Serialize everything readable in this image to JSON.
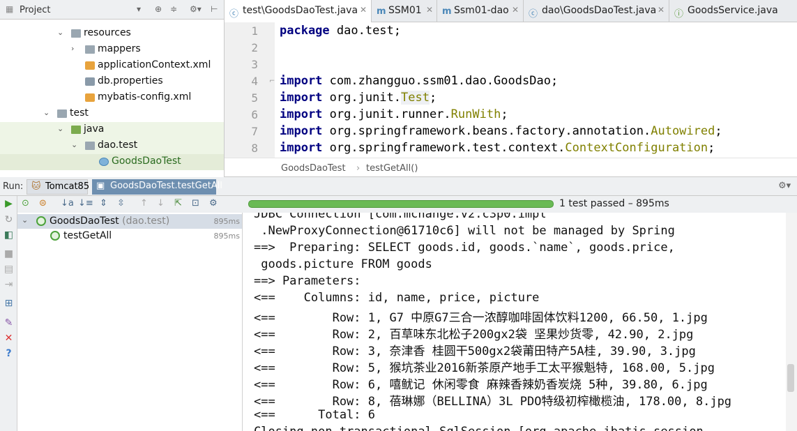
{
  "project_panel": {
    "title": "Project",
    "tree": [
      {
        "label": "resources",
        "kind": "folder",
        "expanded": true
      },
      {
        "label": "mappers",
        "kind": "folder",
        "expanded": false
      },
      {
        "label": "applicationContext.xml",
        "kind": "xml"
      },
      {
        "label": "db.properties",
        "kind": "properties"
      },
      {
        "label": "mybatis-config.xml",
        "kind": "xml"
      },
      {
        "label": "test",
        "kind": "folder",
        "expanded": true
      },
      {
        "label": "java",
        "kind": "folder-green",
        "expanded": true
      },
      {
        "label": "dao.test",
        "kind": "package",
        "expanded": true
      },
      {
        "label": "GoodsDaoTest",
        "kind": "class",
        "selected": true
      }
    ]
  },
  "editor": {
    "tabs": [
      {
        "label": "test\\GoodsDaoTest.java",
        "icon": "class-icon",
        "active": true
      },
      {
        "label": "SSM01",
        "icon": "module-icon"
      },
      {
        "label": "Ssm01-dao",
        "icon": "module-icon"
      },
      {
        "label": "dao\\GoodsDaoTest.java",
        "icon": "class-icon"
      },
      {
        "label": "GoodsService.java",
        "icon": "interface-icon"
      }
    ],
    "line_numbers": [
      "1",
      "2",
      "3",
      "4",
      "5",
      "6",
      "7",
      "8"
    ],
    "code": [
      {
        "kw": "package",
        "rest": " dao.test;",
        "ann": "",
        "tail": ""
      },
      {
        "kw": "",
        "rest": "",
        "ann": "",
        "tail": ""
      },
      {
        "kw": "",
        "rest": "",
        "ann": "",
        "tail": ""
      },
      {
        "kw": "import",
        "rest": " com.zhangguo.ssm01.dao.GoodsDao;",
        "ann": "",
        "tail": ""
      },
      {
        "kw": "import",
        "rest": " org.junit.",
        "ann": "Test",
        "tail": ";"
      },
      {
        "kw": "import",
        "rest": " org.junit.runner.",
        "ann": "RunWith",
        "tail": ";"
      },
      {
        "kw": "import",
        "rest": " org.springframework.beans.factory.annotation.",
        "ann": "Autowired",
        "tail": ";"
      },
      {
        "kw": "import",
        "rest": " org.springframework.test.context.",
        "ann": "ContextConfiguration",
        "tail": ";"
      }
    ],
    "breadcrumb": [
      "GoodsDaoTest",
      "testGetAll()"
    ]
  },
  "run": {
    "label": "Run:",
    "tabs": [
      "Tomcat85",
      "GoodsDaoTest.testGetAll"
    ],
    "progress": 1.0,
    "status": "1 test passed – 895ms",
    "tests": [
      {
        "name": "GoodsDaoTest",
        "pkg": "(dao.test)",
        "time": "895ms"
      },
      {
        "name": "testGetAll",
        "pkg": "",
        "time": "895ms"
      }
    ],
    "console": [
      "JDBC Connection [com.mchange.v2.c3p0.impl",
      " .NewProxyConnection@61710c6] will not be managed by Spring",
      "==>  Preparing: SELECT goods.id, goods.`name`, goods.price,",
      " goods.picture FROM goods",
      "==> Parameters: ",
      "<==    Columns: id, name, price, picture",
      "<==        Row: 1, G7 中原G7三合一浓醇咖啡固体饮料1200, 66.50, 1.jpg",
      "<==        Row: 2, 百草味东北松子200gx2袋 坚果炒货零, 42.90, 2.jpg",
      "<==        Row: 3, 奈津香 桂圆干500gx2袋莆田特产5A桂, 39.90, 3.jpg",
      "<==        Row: 5, 猴坑茶业2016新茶原产地手工太平猴魁特, 168.00, 5.jpg",
      "<==        Row: 6, 嘻鱿记 休闲零食 麻辣香辣奶香炭烧 5种, 39.80, 6.jpg",
      "<==        Row: 8, 蓓琳娜（BELLINA）3L PDO特级初榨橄榄油, 178.00, 8.jpg",
      "<==      Total: 6",
      "Closing non transactional SqlSession [org.apache.ibatis.session"
    ]
  },
  "colors": {
    "keyword": "#000080",
    "annotation": "#808000",
    "pass": "#4ca23b"
  }
}
